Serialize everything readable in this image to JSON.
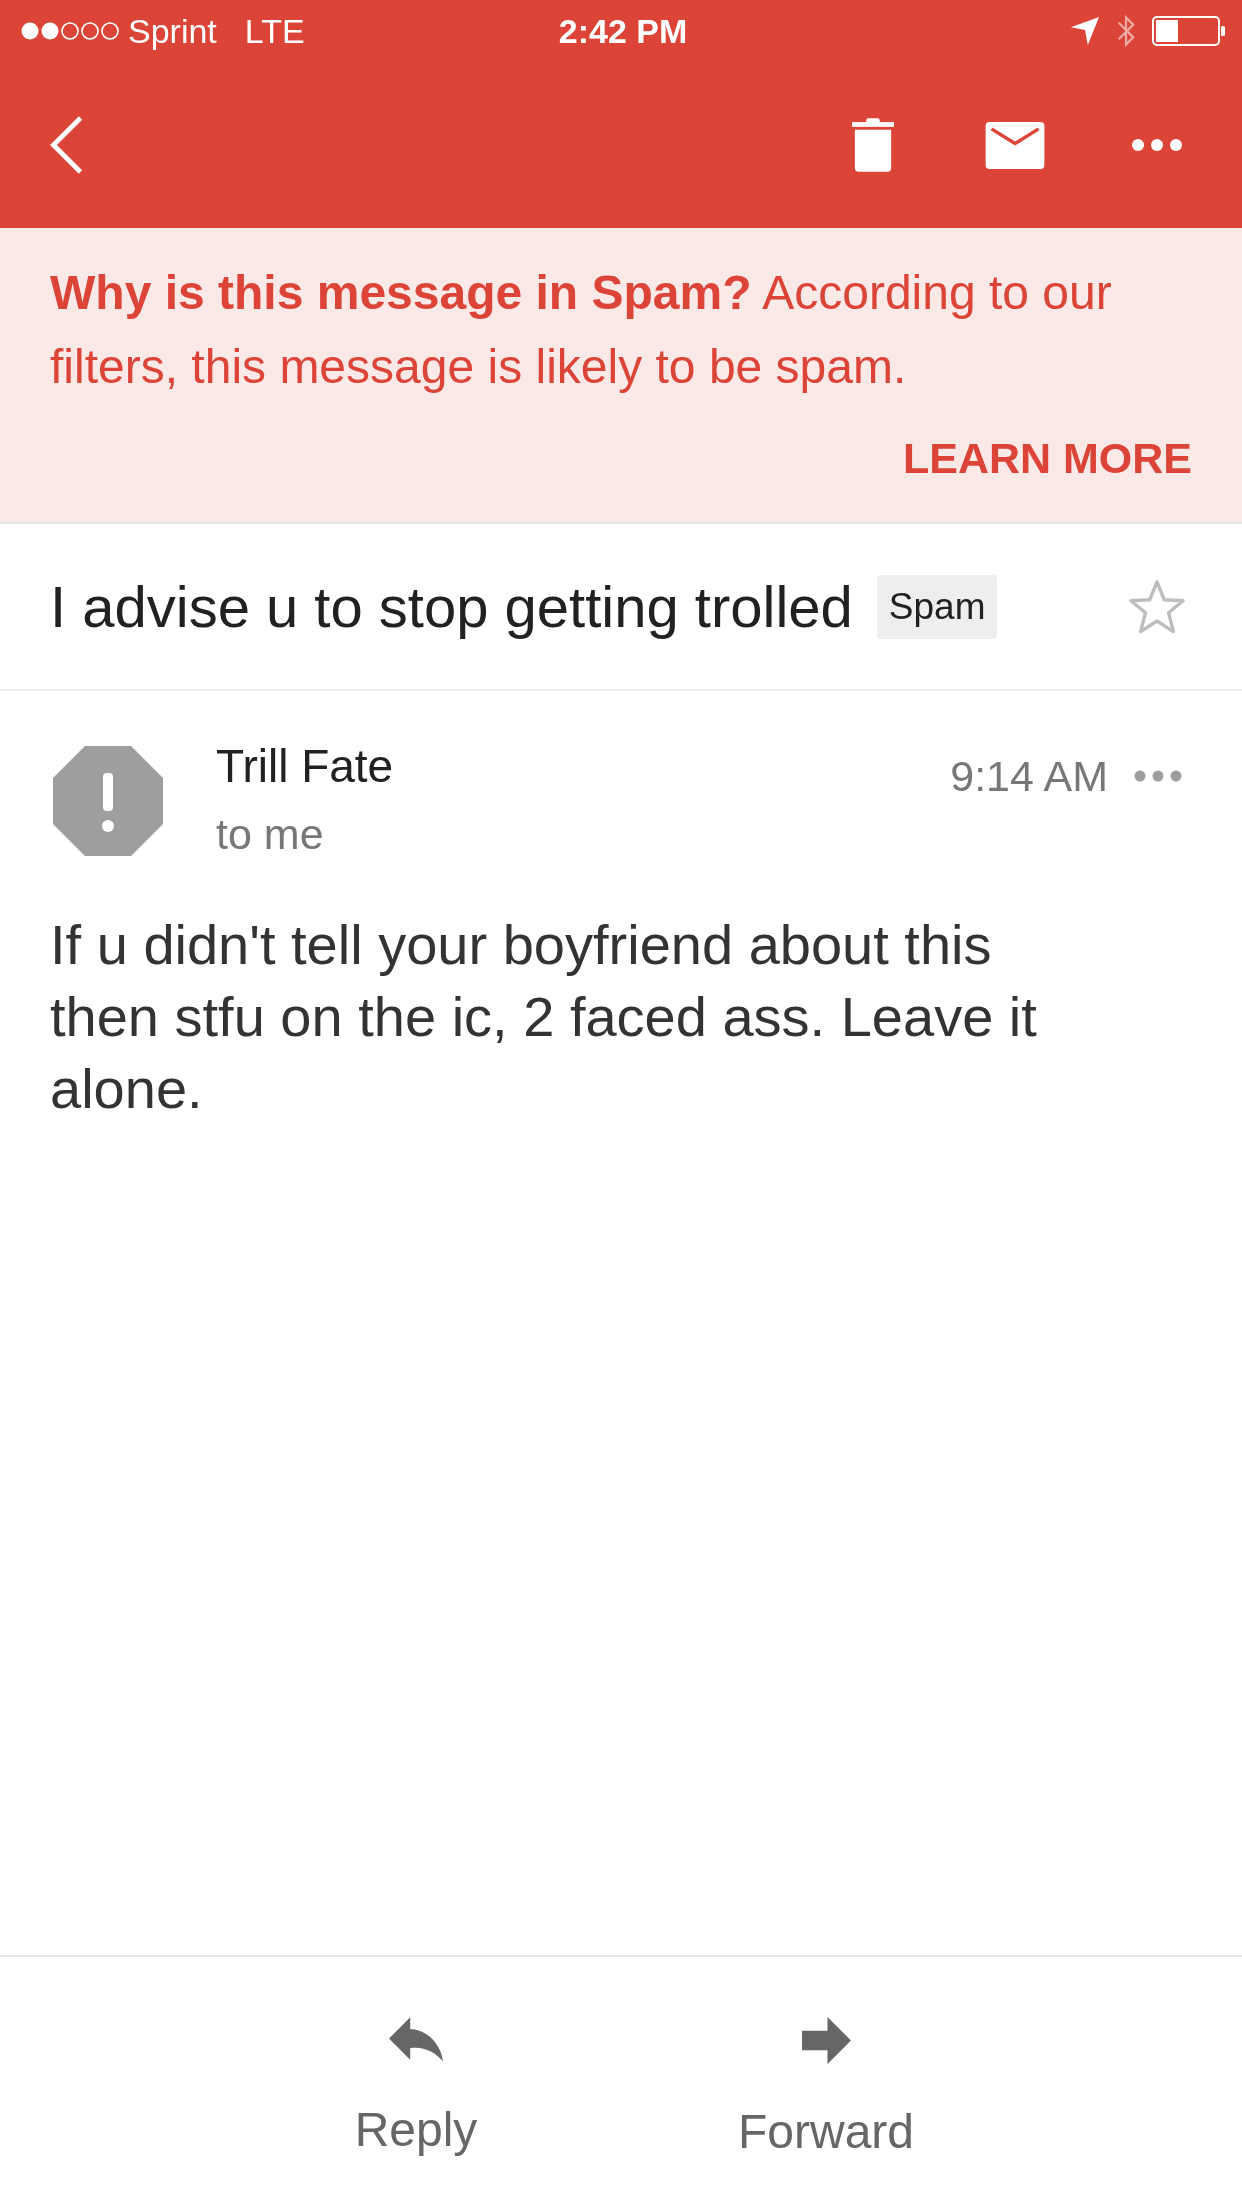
{
  "status_bar": {
    "carrier": "Sprint",
    "network": "LTE",
    "time": "2:42 PM"
  },
  "spam_banner": {
    "text": "**Why is this message in Spam?** According to our filters, this message is likely to be spam.",
    "action": "LEARN MORE"
  },
  "subject": {
    "text": "I advise u to stop getting trolled",
    "label": "Spam",
    "starred": false
  },
  "message": {
    "sender": "Trill Fate",
    "recipient": "to me",
    "time": "9:14 AM",
    "body": "If u didn't tell your boyfriend about this then stfu on the ic, 2 faced ass. Leave it alone."
  },
  "actions": [
    {
      "kind": "reply",
      "label": "Reply"
    },
    {
      "kind": "forward",
      "label": "Forward"
    }
  ]
}
